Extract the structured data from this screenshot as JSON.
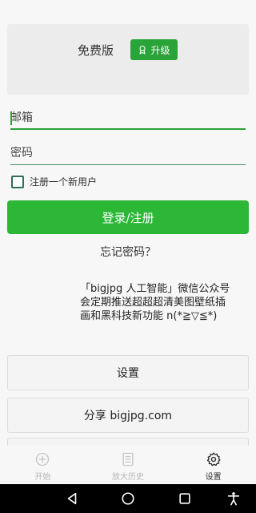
{
  "plan": {
    "label": "免费版",
    "upgrade_label": "升级"
  },
  "login": {
    "email_placeholder": "邮箱",
    "password_placeholder": "密码",
    "register_checkbox_label": "注册一个新用户",
    "submit_label": "登录/注册",
    "forgot_label": "忘记密码？"
  },
  "promo": {
    "line1": "「bigjpg 人工智能」微信公众号",
    "line2": "会定期推送超超超清美图壁纸插",
    "line3": "画和黑科技新功能 n(*≧▽≦*)"
  },
  "menu": {
    "settings_label": "设置",
    "share_label": "分享 bigjpg.com"
  },
  "bottom_nav": {
    "items": [
      {
        "label": "开始",
        "icon": "plus-circle-icon",
        "active": false
      },
      {
        "label": "放大历史",
        "icon": "document-icon",
        "active": false
      },
      {
        "label": "设置",
        "icon": "gear-icon",
        "active": true
      }
    ]
  },
  "colors": {
    "accent": "#2db737",
    "upgrade": "#2aa338"
  }
}
